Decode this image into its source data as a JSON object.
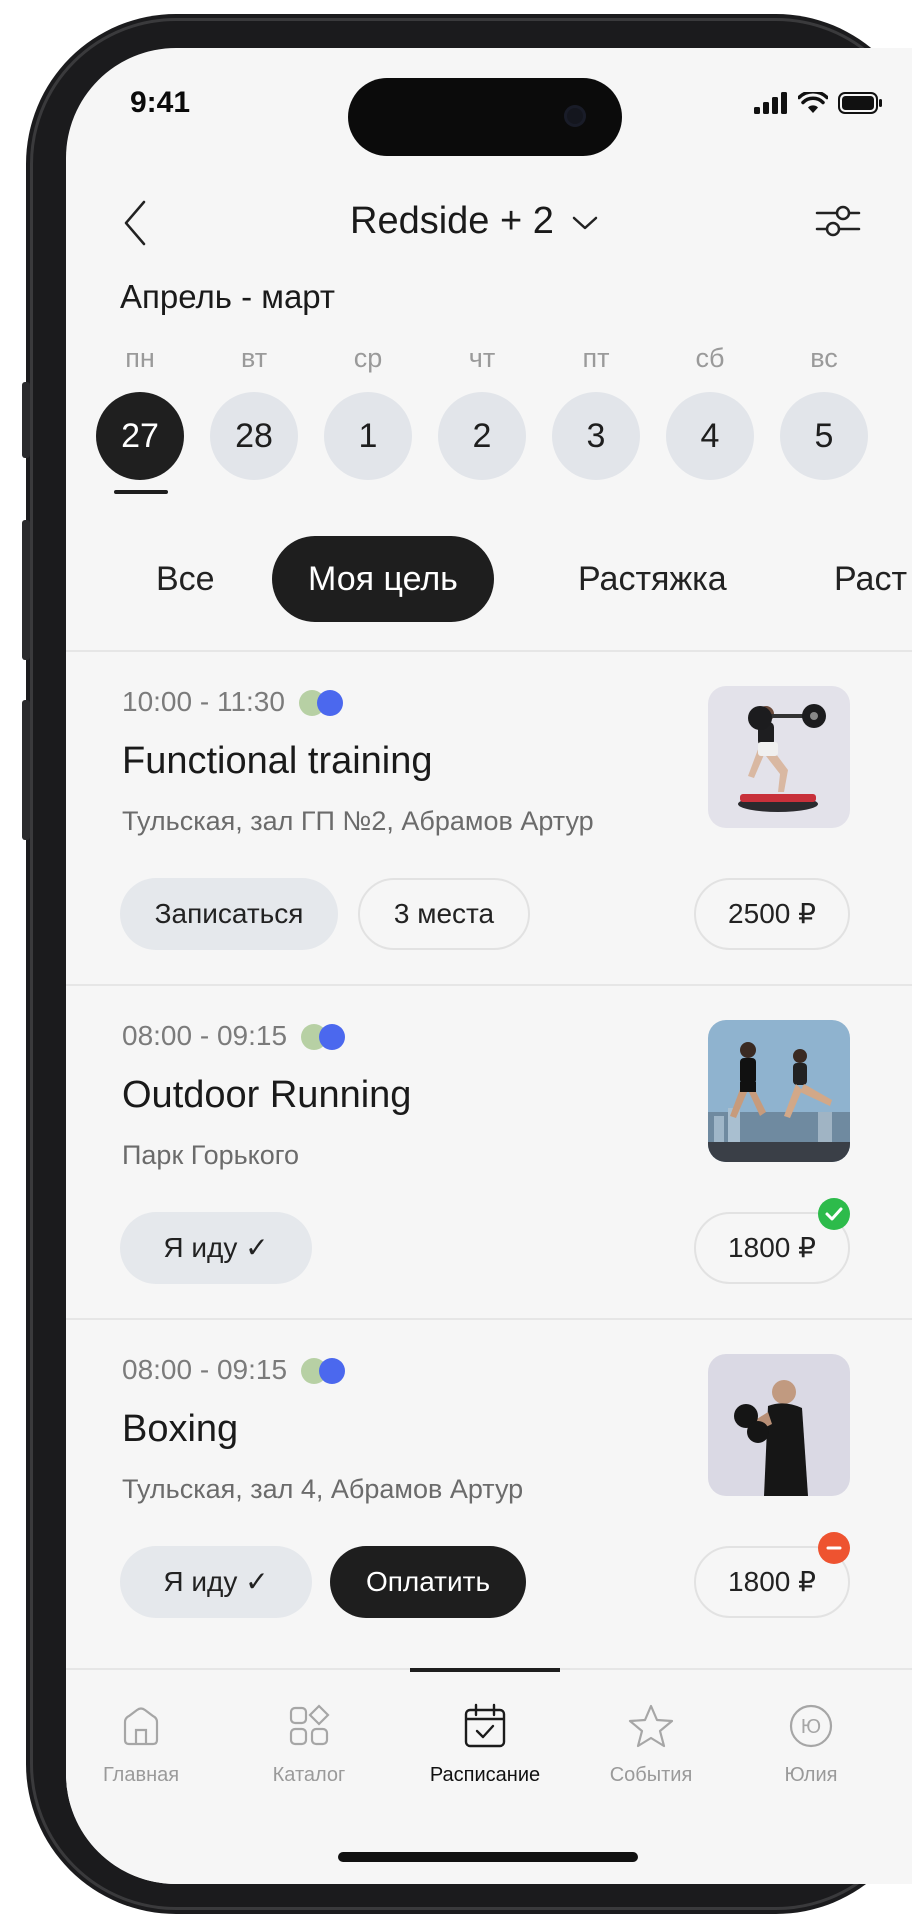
{
  "status": {
    "time": "9:41"
  },
  "header": {
    "title": "Redside + 2"
  },
  "month": "Апрель - март",
  "days": [
    {
      "name": "пн",
      "num": "27",
      "active": true
    },
    {
      "name": "вт",
      "num": "28"
    },
    {
      "name": "ср",
      "num": "1"
    },
    {
      "name": "чт",
      "num": "2"
    },
    {
      "name": "пт",
      "num": "3"
    },
    {
      "name": "сб",
      "num": "4"
    },
    {
      "name": "вс",
      "num": "5"
    }
  ],
  "chips": [
    "Все",
    "Моя цель",
    "Растяжка",
    "Раст"
  ],
  "classes": [
    {
      "time": "10:00 - 11:30",
      "title": "Functional training",
      "subtitle": "Тульская, зал ГП №2, Абрамов Артур",
      "actions": [
        "Записаться",
        "3 места"
      ],
      "price": "2500 ₽"
    },
    {
      "time": "08:00 - 09:15",
      "title": "Outdoor Running",
      "subtitle": "Парк Горького",
      "actions": [
        "Я иду ✓"
      ],
      "price": "1800 ₽",
      "status": "paid"
    },
    {
      "time": "08:00 - 09:15",
      "title": "Boxing",
      "subtitle": "Тульская, зал 4, Абрамов Артур",
      "actions": [
        "Я иду ✓",
        "Оплатить"
      ],
      "price": "1800 ₽",
      "status": "unpaid"
    }
  ],
  "tabs": [
    {
      "label": "Главная",
      "icon": "home-icon"
    },
    {
      "label": "Каталог",
      "icon": "catalog-icon"
    },
    {
      "label": "Расписание",
      "icon": "calendar-icon",
      "active": true
    },
    {
      "label": "События",
      "icon": "star-icon"
    },
    {
      "label": "Юлия",
      "icon": "avatar-icon",
      "avatar_initials": "Ю"
    }
  ],
  "colors": {
    "dark": "#1e1e1e",
    "dot_green": "#b7d0a4",
    "dot_blue": "#4b68ee",
    "paid_badge": "#2dbb4b",
    "unpaid_badge": "#ee5330"
  }
}
